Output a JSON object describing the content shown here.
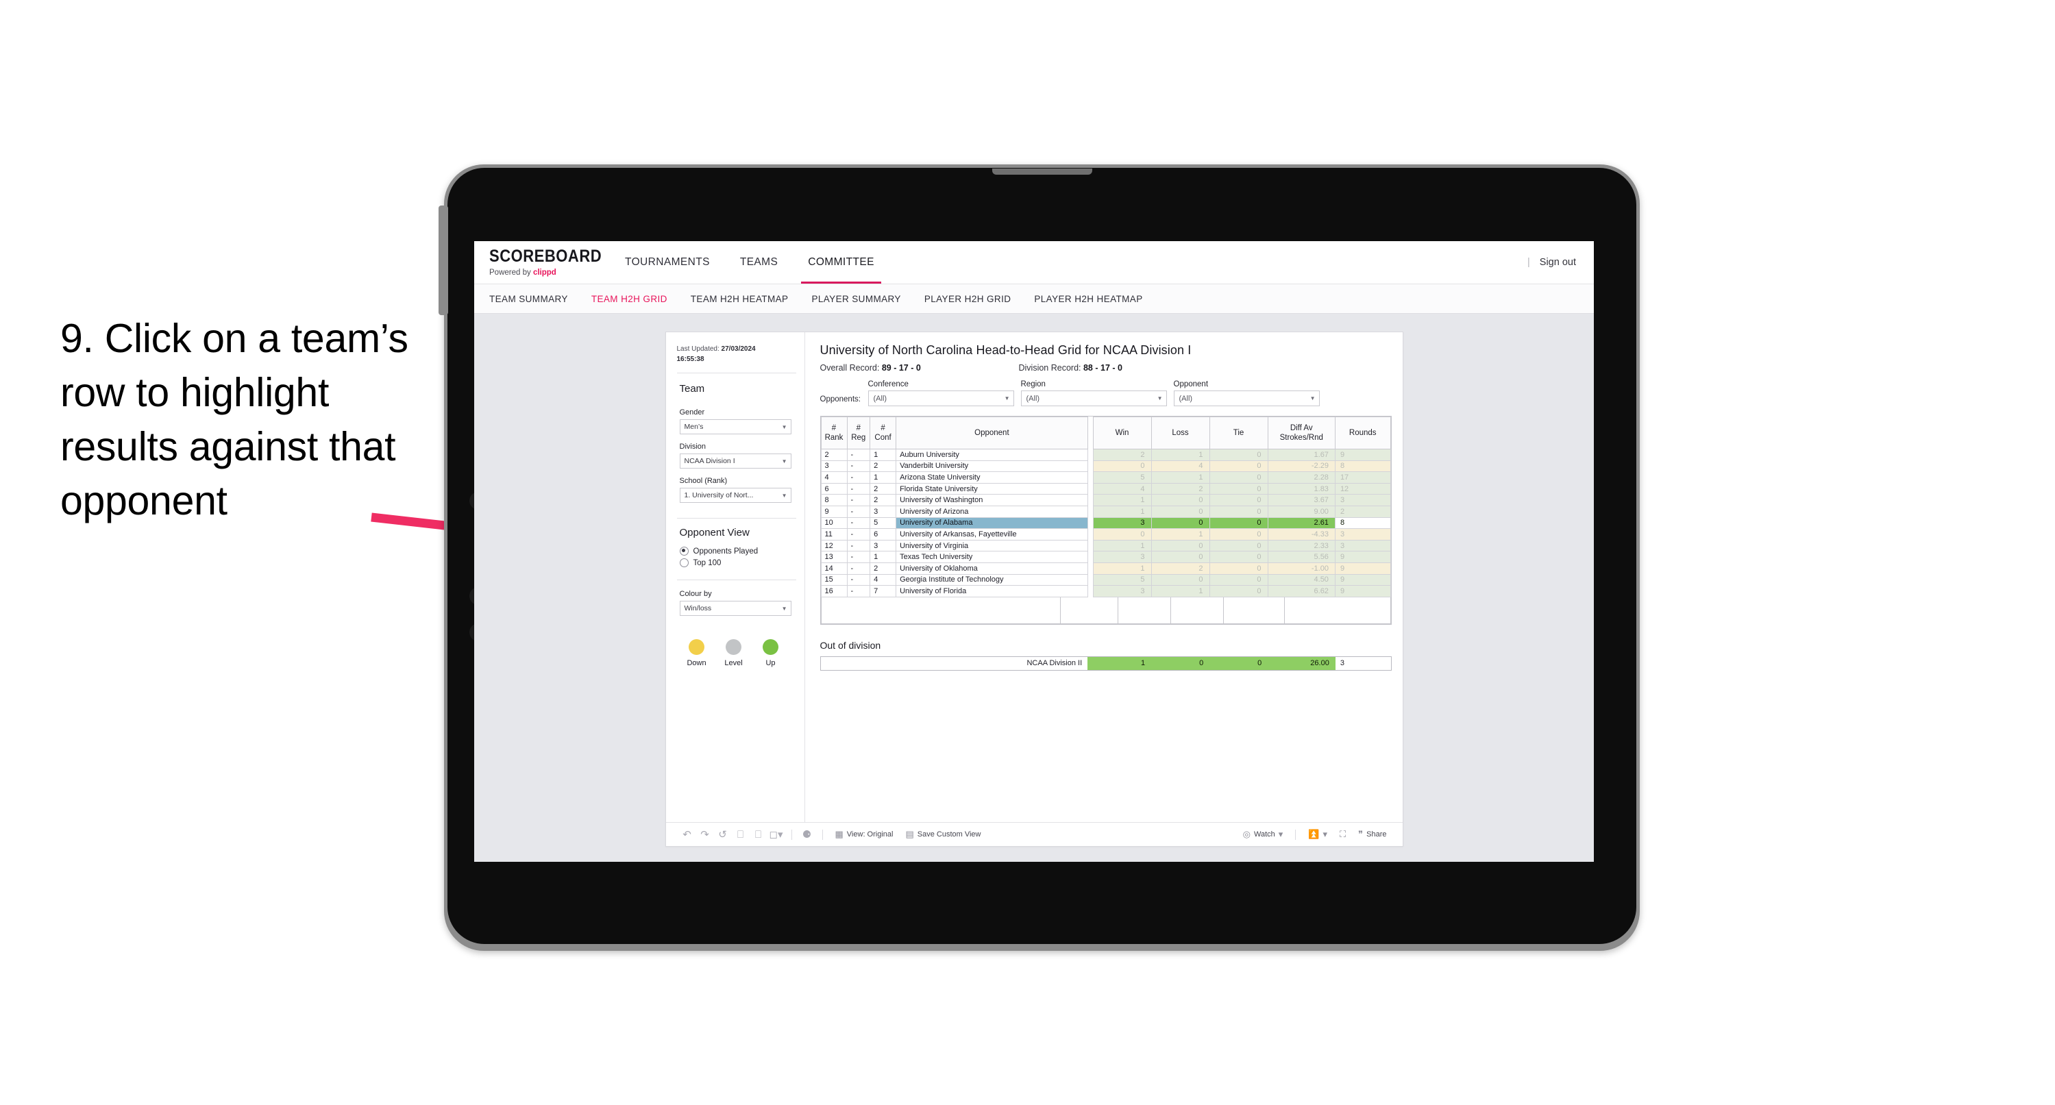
{
  "caption": "9. Click on a team’s row to highlight results against that opponent",
  "topnav": {
    "brand_title": "SCOREBOARD",
    "brand_sub_prefix": "Powered by ",
    "brand_sub_name": "clippd",
    "items": [
      {
        "label": "TOURNAMENTS",
        "active": false
      },
      {
        "label": "TEAMS",
        "active": false
      },
      {
        "label": "COMMITTEE",
        "active": true
      }
    ],
    "separator": "|",
    "signout": "Sign out"
  },
  "subnav": {
    "items": [
      {
        "label": "TEAM SUMMARY",
        "active": false
      },
      {
        "label": "TEAM H2H GRID",
        "active": true
      },
      {
        "label": "TEAM H2H HEATMAP",
        "active": false
      },
      {
        "label": "PLAYER SUMMARY",
        "active": false
      },
      {
        "label": "PLAYER H2H GRID",
        "active": false
      },
      {
        "label": "PLAYER H2H HEATMAP",
        "active": false
      }
    ]
  },
  "sidebar": {
    "last_updated_label": "Last Updated: ",
    "last_updated_value": "27/03/2024 16:55:38",
    "team_heading": "Team",
    "gender_label": "Gender",
    "gender_value": "Men’s",
    "division_label": "Division",
    "division_value": "NCAA Division I",
    "school_label": "School (Rank)",
    "school_value": "1. University of Nort...",
    "opponent_view_heading": "Opponent View",
    "opponent_view_options": [
      {
        "label": "Opponents Played",
        "selected": true
      },
      {
        "label": "Top 100",
        "selected": false
      }
    ],
    "colour_by_label": "Colour by",
    "colour_by_value": "Win/loss",
    "legend": [
      {
        "label": "Down",
        "color": "#f2cf4a"
      },
      {
        "label": "Level",
        "color": "#c2c4c6"
      },
      {
        "label": "Up",
        "color": "#7ac143"
      }
    ]
  },
  "main": {
    "title": "University of North Carolina Head-to-Head Grid for NCAA Division I",
    "overall_record_label": "Overall Record: ",
    "overall_record_value": "89 - 17 - 0",
    "division_record_label": "Division Record: ",
    "division_record_value": "88 - 17 - 0",
    "opponents_label": "Opponents:",
    "filters": [
      {
        "label": "Conference",
        "value": "(All)"
      },
      {
        "label": "Region",
        "value": "(All)"
      },
      {
        "label": "Opponent",
        "value": "(All)"
      }
    ],
    "columns": [
      "# Rank",
      "# Reg",
      "# Conf",
      "Opponent",
      "Win",
      "Loss",
      "Tie",
      "Diff Av Strokes/Rnd",
      "Rounds"
    ],
    "column_lines": {
      "rank": [
        "#",
        "Rank"
      ],
      "reg": [
        "#",
        "Reg"
      ],
      "conf": [
        "#",
        "Conf"
      ],
      "opponent": [
        "Opponent"
      ],
      "win": [
        "Win"
      ],
      "loss": [
        "Loss"
      ],
      "tie": [
        "Tie"
      ],
      "diff": [
        "Diff Av",
        "Strokes/Rnd"
      ],
      "rounds": [
        "Rounds"
      ]
    },
    "rows": [
      {
        "rank": "2",
        "reg": "-",
        "conf": "1",
        "opponent": "Auburn University",
        "win": "2",
        "loss": "1",
        "tie": "0",
        "diff": "1.67",
        "rounds": "9",
        "tone": "up",
        "selected": false
      },
      {
        "rank": "3",
        "reg": "-",
        "conf": "2",
        "opponent": "Vanderbilt University",
        "win": "0",
        "loss": "4",
        "tie": "0",
        "diff": "-2.29",
        "rounds": "8",
        "tone": "down",
        "selected": false
      },
      {
        "rank": "4",
        "reg": "-",
        "conf": "1",
        "opponent": "Arizona State University",
        "win": "5",
        "loss": "1",
        "tie": "0",
        "diff": "2.28",
        "rounds": "17",
        "tone": "up",
        "selected": false
      },
      {
        "rank": "6",
        "reg": "-",
        "conf": "2",
        "opponent": "Florida State University",
        "win": "4",
        "loss": "2",
        "tie": "0",
        "diff": "1.83",
        "rounds": "12",
        "tone": "up",
        "selected": false
      },
      {
        "rank": "8",
        "reg": "-",
        "conf": "2",
        "opponent": "University of Washington",
        "win": "1",
        "loss": "0",
        "tie": "0",
        "diff": "3.67",
        "rounds": "3",
        "tone": "up",
        "selected": false
      },
      {
        "rank": "9",
        "reg": "-",
        "conf": "3",
        "opponent": "University of Arizona",
        "win": "1",
        "loss": "0",
        "tie": "0",
        "diff": "9.00",
        "rounds": "2",
        "tone": "up",
        "selected": false
      },
      {
        "rank": "10",
        "reg": "-",
        "conf": "5",
        "opponent": "University of Alabama",
        "win": "3",
        "loss": "0",
        "tie": "0",
        "diff": "2.61",
        "rounds": "8",
        "tone": "up",
        "selected": true
      },
      {
        "rank": "11",
        "reg": "-",
        "conf": "6",
        "opponent": "University of Arkansas, Fayetteville",
        "win": "0",
        "loss": "1",
        "tie": "0",
        "diff": "-4.33",
        "rounds": "3",
        "tone": "down",
        "selected": false
      },
      {
        "rank": "12",
        "reg": "-",
        "conf": "3",
        "opponent": "University of Virginia",
        "win": "1",
        "loss": "0",
        "tie": "0",
        "diff": "2.33",
        "rounds": "3",
        "tone": "up",
        "selected": false
      },
      {
        "rank": "13",
        "reg": "-",
        "conf": "1",
        "opponent": "Texas Tech University",
        "win": "3",
        "loss": "0",
        "tie": "0",
        "diff": "5.56",
        "rounds": "9",
        "tone": "up",
        "selected": false
      },
      {
        "rank": "14",
        "reg": "-",
        "conf": "2",
        "opponent": "University of Oklahoma",
        "win": "1",
        "loss": "2",
        "tie": "0",
        "diff": "-1.00",
        "rounds": "9",
        "tone": "down",
        "selected": false
      },
      {
        "rank": "15",
        "reg": "-",
        "conf": "4",
        "opponent": "Georgia Institute of Technology",
        "win": "5",
        "loss": "0",
        "tie": "0",
        "diff": "4.50",
        "rounds": "9",
        "tone": "up",
        "selected": false
      },
      {
        "rank": "16",
        "reg": "-",
        "conf": "7",
        "opponent": "University of Florida",
        "win": "3",
        "loss": "1",
        "tie": "0",
        "diff": "6.62",
        "rounds": "9",
        "tone": "up",
        "selected": false
      }
    ],
    "out_of_division": {
      "title": "Out of division",
      "row": {
        "name": "NCAA Division II",
        "win": "1",
        "loss": "0",
        "tie": "0",
        "diff": "26.00",
        "rounds": "3"
      }
    }
  },
  "toolbar": {
    "icons": [
      "undo-icon",
      "redo-icon",
      "revert-icon",
      "refresh-icon",
      "pause-icon",
      "chevron-dropdown-icon",
      "help-icon"
    ],
    "view_original": "View: Original",
    "save_custom_view": "Save Custom View",
    "watch": "Watch",
    "share": "Share"
  },
  "colors": {
    "accent": "#e8155b",
    "selected_row": "#87b6cd",
    "win_green": "#83c75c",
    "up": "#7ac143",
    "level": "#c2c4c6",
    "down": "#f2cf4a",
    "arrow": "#ef2d63"
  }
}
